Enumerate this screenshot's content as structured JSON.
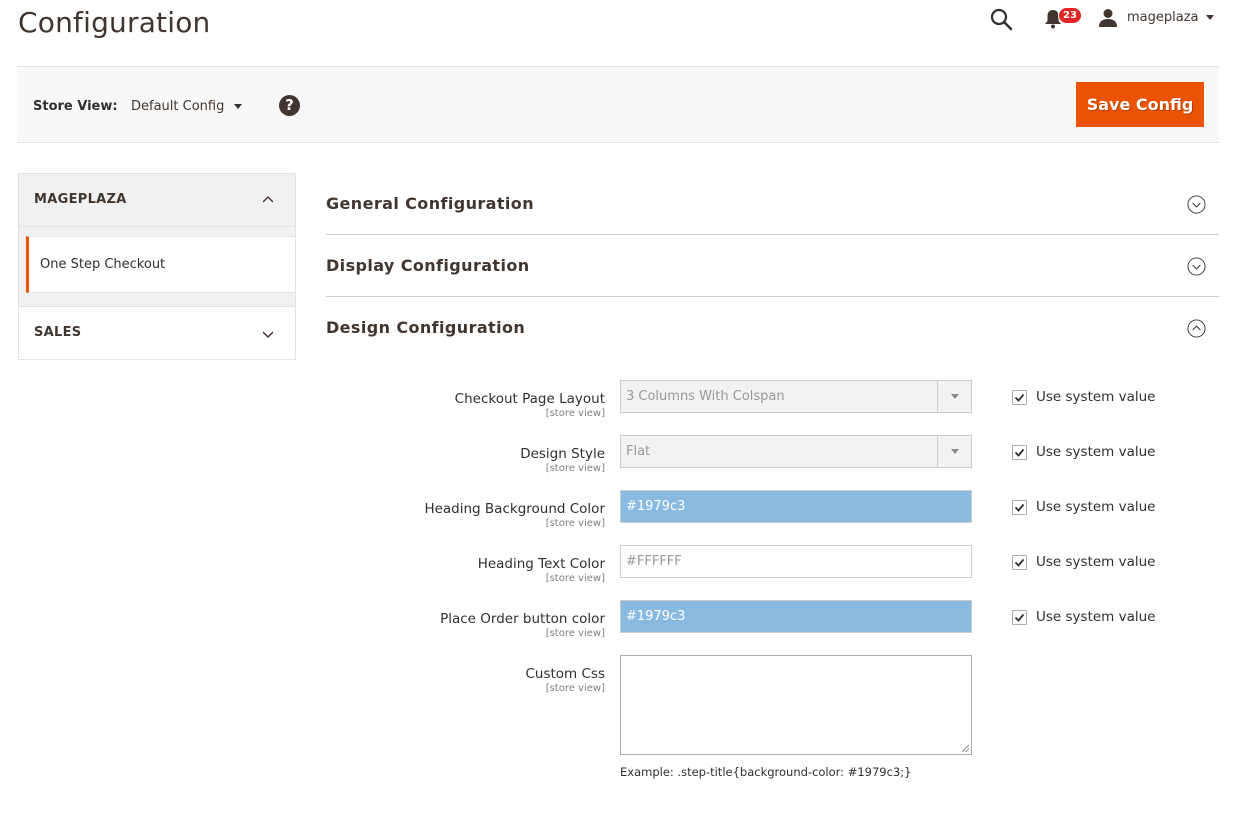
{
  "header": {
    "title": "Configuration",
    "notifications_count": "23",
    "username": "mageplaza"
  },
  "store_bar": {
    "label": "Store View:",
    "selected_scope": "Default Config",
    "help": "?",
    "save_label": "Save Config"
  },
  "sidebar": {
    "groups": [
      {
        "label": "MAGEPLAZA",
        "expanded": true,
        "items": [
          {
            "label": "One Step Checkout",
            "active": true
          }
        ]
      },
      {
        "label": "SALES",
        "expanded": false,
        "items": []
      }
    ]
  },
  "sections": [
    {
      "title": "General Configuration",
      "expanded": false
    },
    {
      "title": "Display Configuration",
      "expanded": false
    },
    {
      "title": "Design Configuration",
      "expanded": true
    }
  ],
  "design_fields": [
    {
      "label": "Checkout Page Layout",
      "scope": "[store view]",
      "type": "select",
      "value": "3 Columns With Colspan",
      "use_system_value": true
    },
    {
      "label": "Design Style",
      "scope": "[store view]",
      "type": "select",
      "value": "Flat",
      "use_system_value": true
    },
    {
      "label": "Heading Background Color",
      "scope": "[store view]",
      "type": "color",
      "value": "#1979c3",
      "use_system_value": true
    },
    {
      "label": "Heading Text Color",
      "scope": "[store view]",
      "type": "text",
      "value": "#FFFFFF",
      "use_system_value": true
    },
    {
      "label": "Place Order button color",
      "scope": "[store view]",
      "type": "color",
      "value": "#1979c3",
      "use_system_value": true
    },
    {
      "label": "Custom Css",
      "scope": "[store view]",
      "type": "textarea",
      "value": "",
      "hint": "Example: .step-title{background-color: #1979c3;}"
    }
  ],
  "use_system_value_label": "Use system value",
  "colors": {
    "accent": "#eb5202",
    "color_swatch_bg": "#8bbae1",
    "badge": "#e22626"
  }
}
